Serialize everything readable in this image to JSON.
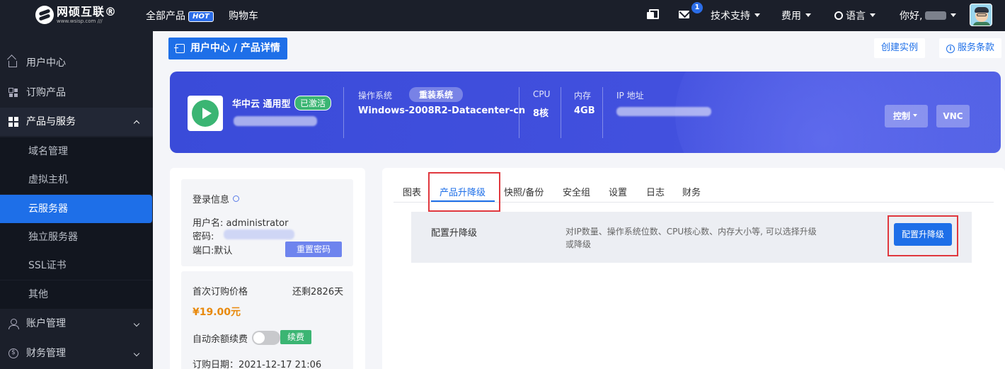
{
  "topbar": {
    "logo_name": "网硕互联®",
    "logo_url": "www.wsisp.com ///",
    "nav": {
      "all_products": "全部产品",
      "hot_badge": "HOT",
      "cart": "购物车"
    },
    "message_count": "1",
    "tech_support": "技术支持",
    "billing": "费用",
    "language": "语言",
    "greeting": "你好,"
  },
  "sidebar": {
    "items": [
      {
        "label": "用户中心",
        "icon": "home-icon"
      },
      {
        "label": "订购产品",
        "icon": "grid-icon"
      },
      {
        "label": "产品与服务",
        "icon": "grid-filled-icon"
      }
    ],
    "sub_items": [
      "域名管理",
      "虚拟主机",
      "云服务器",
      "独立服务器",
      "SSL证书",
      "其他"
    ],
    "active_sub": "云服务器",
    "bottom_items": [
      {
        "label": "账户管理",
        "icon": "user-icon"
      },
      {
        "label": "财务管理",
        "icon": "coin-icon"
      }
    ]
  },
  "breadcrumb": "用户中心 / 产品详情",
  "actions": {
    "create_instance": "创建实例",
    "service_terms": "服务条款"
  },
  "server": {
    "name": "华中云 通用型",
    "status": "已激活",
    "os_label": "操作系统",
    "reinstall": "重装系统",
    "os_value": "Windows-2008R2-Datacenter-cn",
    "cpu_label": "CPU",
    "cpu_value": "8核",
    "mem_label": "内存",
    "mem_value": "4GB",
    "ip_label": "IP 地址",
    "control": "控制",
    "vnc": "VNC"
  },
  "login": {
    "title": "登录信息",
    "username_label": "用户名:",
    "username": "administrator",
    "password_label": "密码:",
    "port_label": "端口:",
    "port": "默认",
    "reset": "重置密码"
  },
  "billing": {
    "first_price_label": "首次订购价格",
    "remaining": "还剩2826天",
    "price": "¥19.00元",
    "auto_renew_label": "自动余额续费",
    "renew": "续费",
    "order_date": "订购日期：2021-12-17 21:06"
  },
  "tabs": [
    "图表",
    "产品升降级",
    "快照/备份",
    "安全组",
    "设置",
    "日志",
    "财务"
  ],
  "active_tab": "产品升降级",
  "upgrade": {
    "title": "配置升降级",
    "desc": "对IP数量、操作系统位数、CPU核心数、内存大小等, 可以选择升级或降级",
    "button": "配置升降级"
  },
  "colors": {
    "primary": "#1e6fe8",
    "sidebar_bg": "#1b1f2a",
    "success": "#3bb573",
    "price": "#e8890c",
    "highlight_box": "#e0383e"
  }
}
